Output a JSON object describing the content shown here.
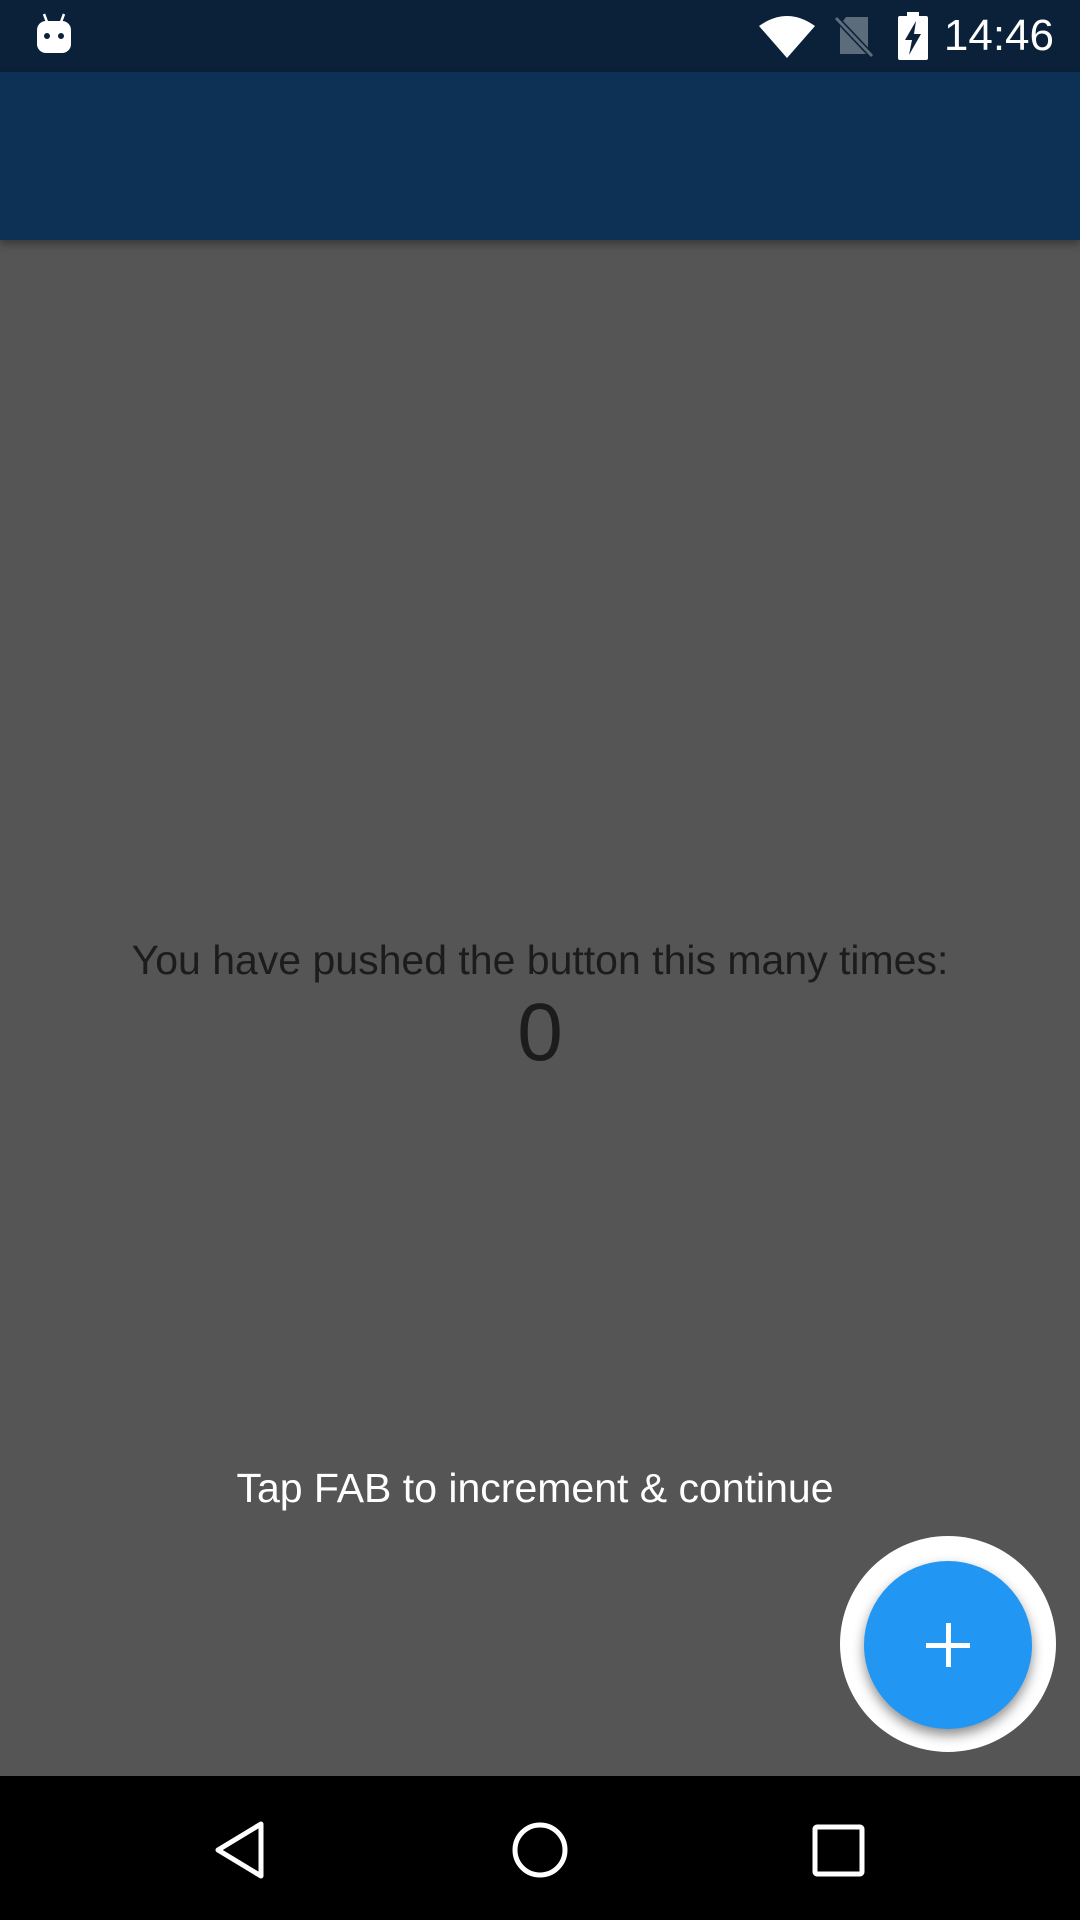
{
  "status_bar": {
    "time": "14:46",
    "icons": [
      "android-debug-icon",
      "wifi-icon",
      "no-sim-icon",
      "battery-charging-icon"
    ]
  },
  "app_bar": {
    "title": ""
  },
  "main": {
    "counter_label": "You have pushed the button this many times:",
    "counter_value": "0",
    "hint": "Tap FAB to increment & continue"
  },
  "fab": {
    "icon": "plus-icon",
    "color": "#2196f3"
  },
  "nav_bar": {
    "icons": [
      "back-icon",
      "home-icon",
      "recents-icon"
    ]
  },
  "colors": {
    "status_bar": "#0a2139",
    "app_bar": "#0c3154",
    "content_background": "#555555",
    "nav_bar": "#000000"
  }
}
